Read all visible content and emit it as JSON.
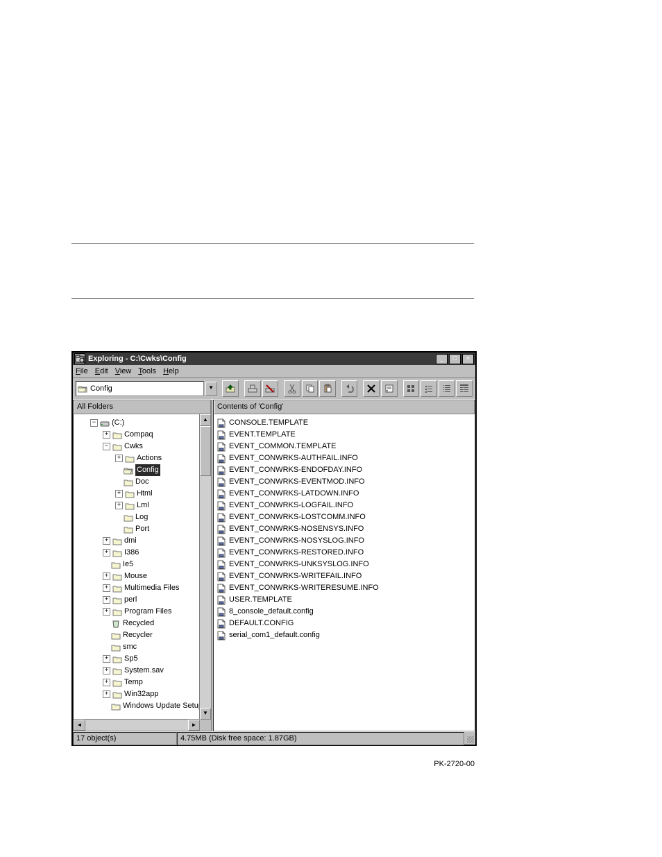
{
  "window_title": "Exploring - C:\\Cwks\\Config",
  "menus": {
    "file": "File",
    "edit": "Edit",
    "view": "View",
    "tools": "Tools",
    "help": "Help"
  },
  "address": {
    "folder_label": "Config"
  },
  "left_header": "All Folders",
  "right_header": "Contents of 'Config'",
  "tree": {
    "c_drive": "(C:)",
    "items": [
      "Compaq",
      "Cwks",
      "Actions",
      "Config",
      "Doc",
      "Html",
      "Lml",
      "Log",
      "Port",
      "dmi",
      "I386",
      "Ie5",
      "Mouse",
      "Multimedia Files",
      "perl",
      "Program Files",
      "Recycled",
      "Recycler",
      "smc",
      "Sp5",
      "System.sav",
      "Temp",
      "Win32app",
      "Windows Update Setup"
    ]
  },
  "files": [
    "CONSOLE.TEMPLATE",
    "EVENT.TEMPLATE",
    "EVENT_COMMON.TEMPLATE",
    "EVENT_CONWRKS-AUTHFAIL.INFO",
    "EVENT_CONWRKS-ENDOFDAY.INFO",
    "EVENT_CONWRKS-EVENTMOD.INFO",
    "EVENT_CONWRKS-LATDOWN.INFO",
    "EVENT_CONWRKS-LOGFAIL.INFO",
    "EVENT_CONWRKS-LOSTCOMM.INFO",
    "EVENT_CONWRKS-NOSENSYS.INFO",
    "EVENT_CONWRKS-NOSYSLOG.INFO",
    "EVENT_CONWRKS-RESTORED.INFO",
    "EVENT_CONWRKS-UNKSYSLOG.INFO",
    "EVENT_CONWRKS-WRITEFAIL.INFO",
    "EVENT_CONWRKS-WRITERESUME.INFO",
    "USER.TEMPLATE",
    "8_console_default.config",
    "DEFAULT.CONFIG",
    "serial_com1_default.config"
  ],
  "status": {
    "objects": "17 object(s)",
    "space": "4.75MB (Disk free space: 1.87GB)"
  },
  "figure_id": "PK-2720-00"
}
